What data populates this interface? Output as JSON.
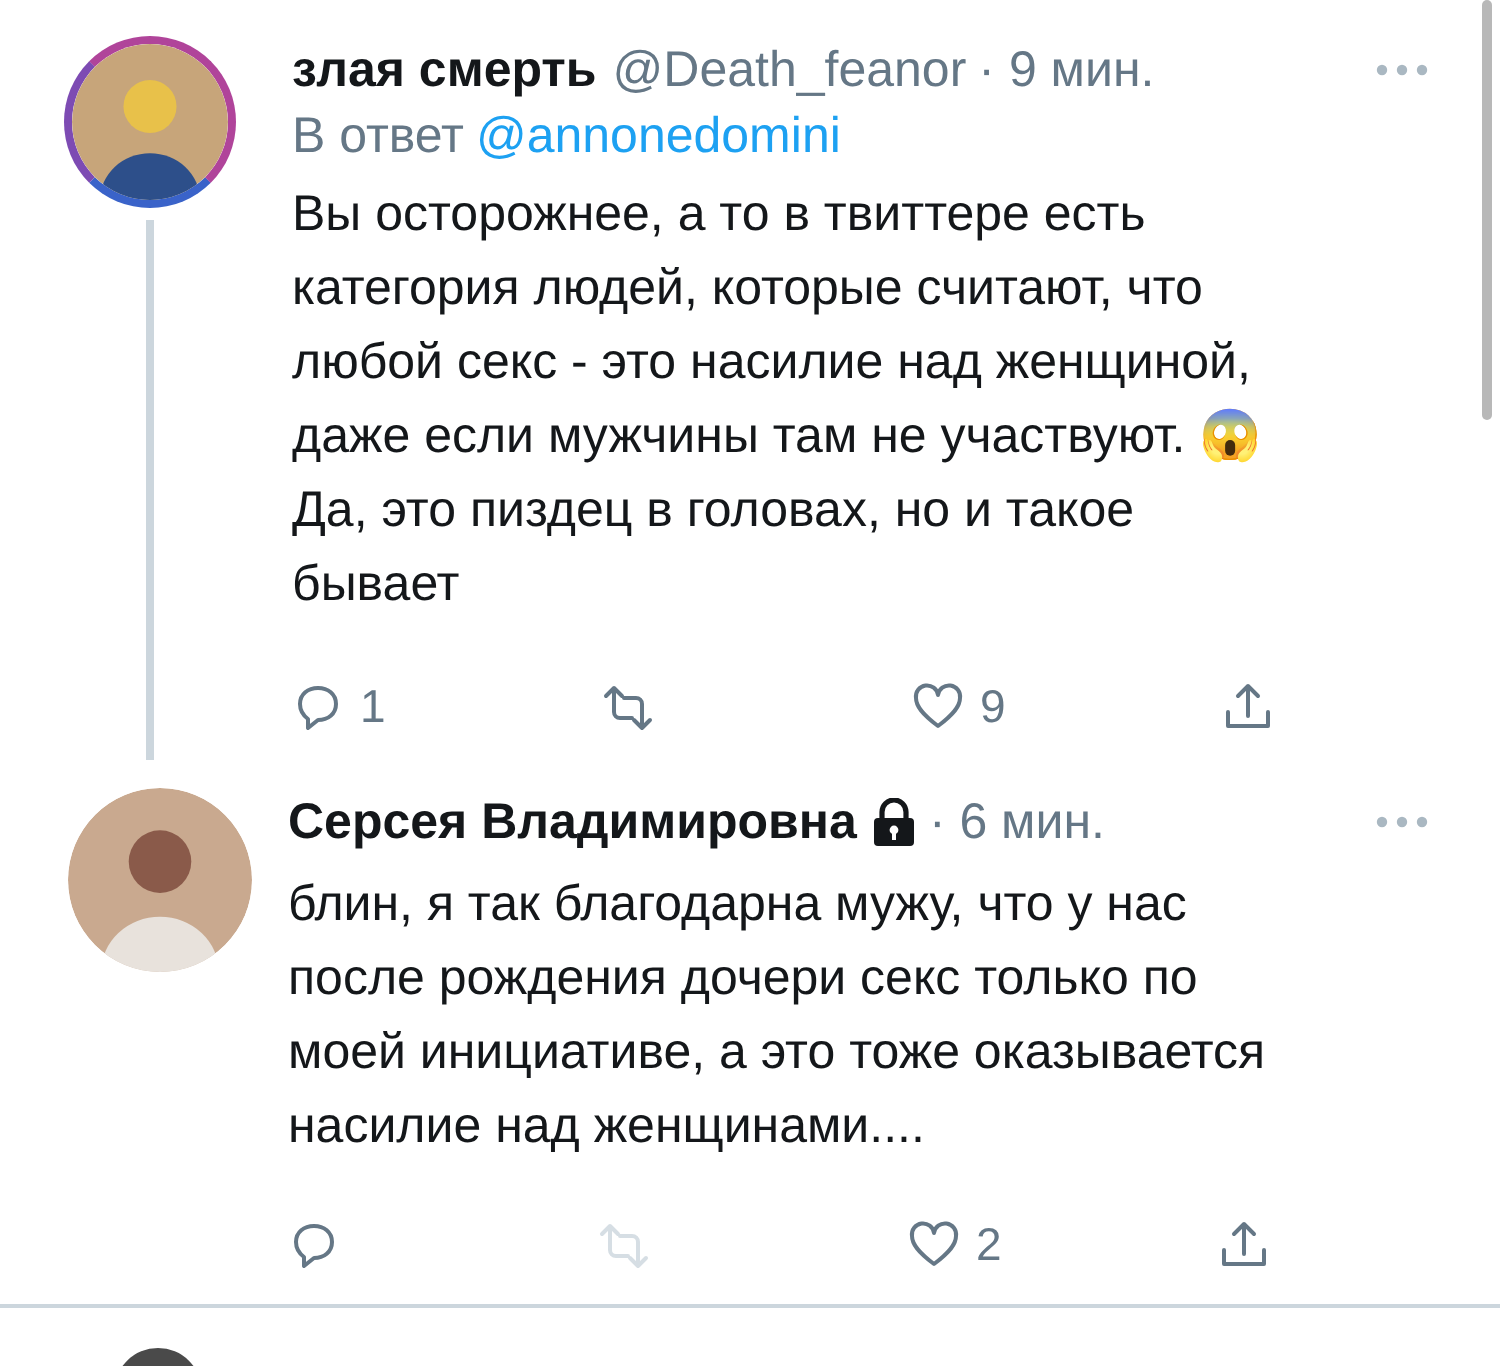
{
  "tweets": [
    {
      "name": "злая смерть",
      "handle": "@Death_feanor",
      "time": "· 9 мин.",
      "locked": false,
      "avatar_ring": true,
      "thread_line": true,
      "reply_to": {
        "prefix": "В ответ",
        "mention": "@annonedomini"
      },
      "text": "Вы осторожнее, а то в твиттере есть\nкатегория людей, которые считают, что\nлюбой секс - это насилие над женщиной,\nдаже если мужчины там не участвуют. 😱\nДа, это пиздец в головах, но и такое\nбывает",
      "actions": [
        {
          "kind": "reply",
          "count": "1",
          "disabled": false
        },
        {
          "kind": "retweet",
          "disabled": false
        },
        {
          "kind": "like",
          "count": "9",
          "disabled": false
        },
        {
          "kind": "share",
          "disabled": false
        }
      ]
    },
    {
      "name": "Серсея Владимировна",
      "time": "· 6 мин.",
      "locked": true,
      "avatar_ring": false,
      "thread_line": false,
      "text": "блин, я так благодарна мужу, что у нас\nпосле рождения дочери секс только по\nмоей инициативе, а это тоже оказывается\nнасилие над женщинами....",
      "actions": [
        {
          "kind": "reply",
          "disabled": false
        },
        {
          "kind": "retweet",
          "disabled": true
        },
        {
          "kind": "like",
          "count": "2",
          "disabled": false
        },
        {
          "kind": "share",
          "disabled": false
        }
      ]
    }
  ]
}
